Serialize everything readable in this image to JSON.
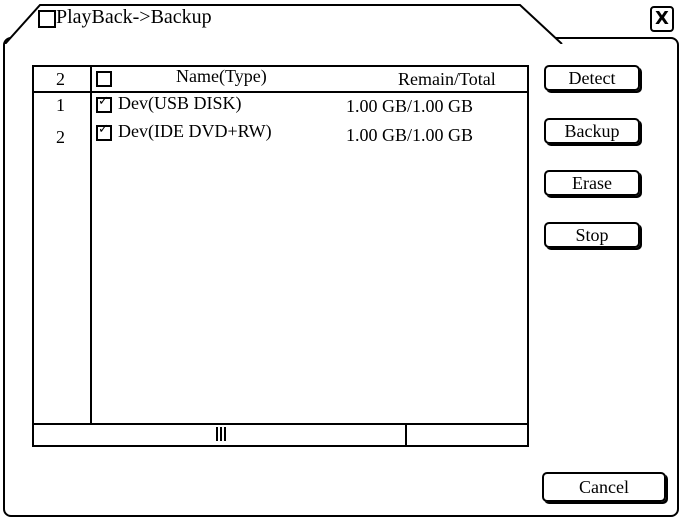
{
  "window": {
    "title": "PlayBack->Backup"
  },
  "list": {
    "count_header": "2",
    "name_header": "Name(Type)",
    "remain_header": "Remain/Total",
    "rows": [
      {
        "index": "1",
        "name": "Dev(USB DISK)",
        "remain": "1.00 GB/1.00 GB",
        "checked": true
      },
      {
        "index": "2",
        "name": "Dev(IDE DVD+RW)",
        "remain": "1.00 GB/1.00 GB",
        "checked": true
      }
    ]
  },
  "buttons": {
    "detect": "Detect",
    "backup": "Backup",
    "erase": "Erase",
    "stop": "Stop",
    "cancel": "Cancel"
  },
  "icons": {
    "close": "close-icon"
  }
}
